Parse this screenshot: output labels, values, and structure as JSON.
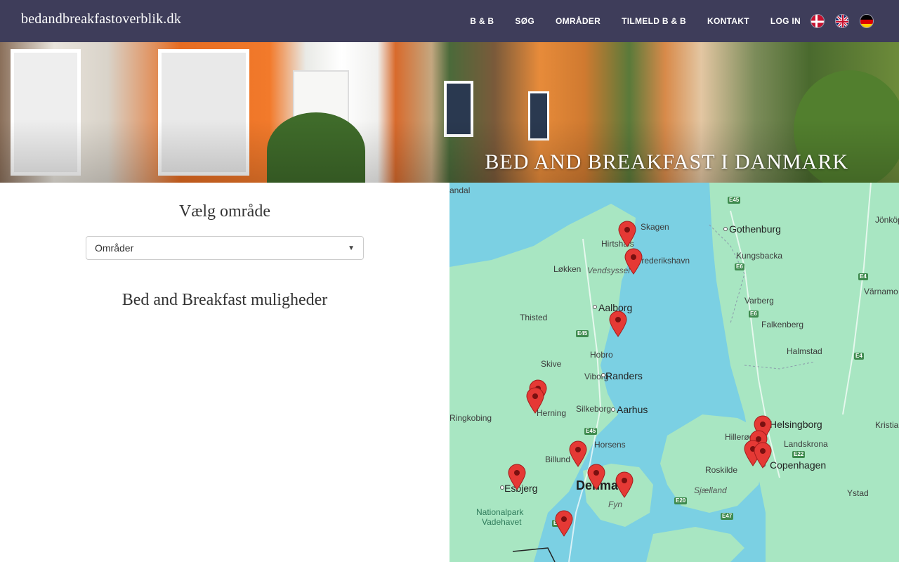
{
  "nav": {
    "brand": "bedandbreakfastoverblik.dk",
    "links": [
      "B & B",
      "SØG",
      "OMRÅDER",
      "TILMELD B & B",
      "KONTAKT",
      "LOG IN"
    ],
    "flags": [
      "danish-flag-icon",
      "uk-flag-icon",
      "german-flag-icon"
    ]
  },
  "hero": {
    "title": "BED AND BREAKFAST I DANMARK"
  },
  "left": {
    "choose_heading": "Vælg område",
    "select_value": "Områder",
    "options_heading": "Bed and Breakfast muligheder"
  },
  "map": {
    "labels": {
      "andal": "andal",
      "skagen": "Skagen",
      "hirtshals": "Hirtshals",
      "frederikshavn": "Frederikshavn",
      "lokken": "Løkken",
      "vendsyssel": "Vendsyssel",
      "aalborg": "Aalborg",
      "thisted": "Thisted",
      "hobro": "Hobro",
      "skive": "Skive",
      "viborg": "Viborg",
      "randers": "Randers",
      "herning": "Herning",
      "silkeborg": "Silkeborg",
      "aarhus": "Aarhus",
      "ringkobing": "Ringkobing",
      "horsens": "Horsens",
      "billund": "Billund",
      "esbjerg": "Esbjerg",
      "denmark": "Denmark",
      "fyn": "Fyn",
      "nationalpark": "Nationalpark",
      "vadehavet": "Vadehavet",
      "gothenburg": "Gothenburg",
      "kungsbacka": "Kungsbacka",
      "varberg": "Varberg",
      "falkenberg": "Falkenberg",
      "halmstad": "Halmstad",
      "helsingborg": "Helsingborg",
      "hillerod": "Hillerød",
      "landskrona": "Landskrona",
      "roskilde": "Roskilde",
      "copenhagen": "Copenhagen",
      "sjaelland": "Sjælland",
      "ystad": "Ystad",
      "jonkoping": "Jönköp",
      "varnamo": "Värnamo",
      "kristian": "Kristian"
    },
    "roads": [
      "E45",
      "E6",
      "E4",
      "E45",
      "E6",
      "E4",
      "E45",
      "E45",
      "E20",
      "E47",
      "E22"
    ],
    "marker_count": 14,
    "colors": {
      "water": "#7bd0e3",
      "land": "#a8e6c2",
      "marker": "#e53935"
    }
  }
}
